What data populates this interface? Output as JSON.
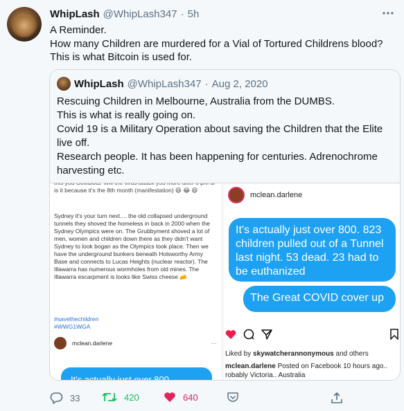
{
  "tweet": {
    "author_name": "WhipLash",
    "author_handle": "@WhipLash347",
    "separator": "·",
    "time": "5h",
    "more_icon": "more-icon",
    "text_lines": [
      "A Reminder.",
      "How many Children are murdered for a Vial of Tortured Childrens blood?",
      "This is what Bitcoin is used for."
    ]
  },
  "quote": {
    "author_name": "WhipLash",
    "author_handle": "@WhipLash347",
    "separator": "·",
    "date": "Aug 2, 2020",
    "text_lines": [
      "Rescuing Children in Melbourne, Australia from the DUMBS.",
      "This is what is really going on.",
      "Covid 19 is a Military Operation about saving the Children that the Elite live off.",
      "Research people. It has been happening for centuries. Adrenochrome harvesting etc."
    ]
  },
  "media_left": {
    "top_clip": "this you Covidiots. Will the virus attack you more after 8 pm or is it because it's the 8th month (manifestation) 😆 😂 😆",
    "body": "Sydney it's your turn next.... the old collapsed underground tunnels they shoved the homeless in back in 2000 when the Sydney Olympics were on. The Grubbyment shoved a lot of men, women and children down there as they didn't want Sydney to look bogan as the Olympics took place. Then we have the underground bunkers beneath Holsworthy Army Base and connects to Lucas Heights (nuclear reactor). The Illawarra has numerous wormholes from old mines. The Illawarra escarpment is looks like Swiss cheese 🧀",
    "tags": [
      "#savethechildren",
      "#WWG1WGA"
    ],
    "username": "mclean.darlene",
    "dots": "···",
    "bubble_text": "It's actually just over 800."
  },
  "media_right": {
    "username": "mclean.darlene",
    "bubble1": "It's actually just over 800. 823 children pulled out of a Tunnel last night. 53 dead. 23 had to be euthanized",
    "bubble2": "The Great COVID cover up",
    "liked_prefix": "Liked by ",
    "liked_user": "skywatcherannonymous",
    "liked_suffix": " and others",
    "caption_user": "mclean.darlene",
    "caption_text": " Posted on Facebook 10 hours ago.. robably Victoria.. Australia"
  },
  "actions": {
    "replies": "33",
    "retweets": "420",
    "likes": "640"
  },
  "colors": {
    "retweet": "#17bf63",
    "like": "#e0245e",
    "muted": "#5b7083",
    "bubble": "#1da1f2"
  }
}
